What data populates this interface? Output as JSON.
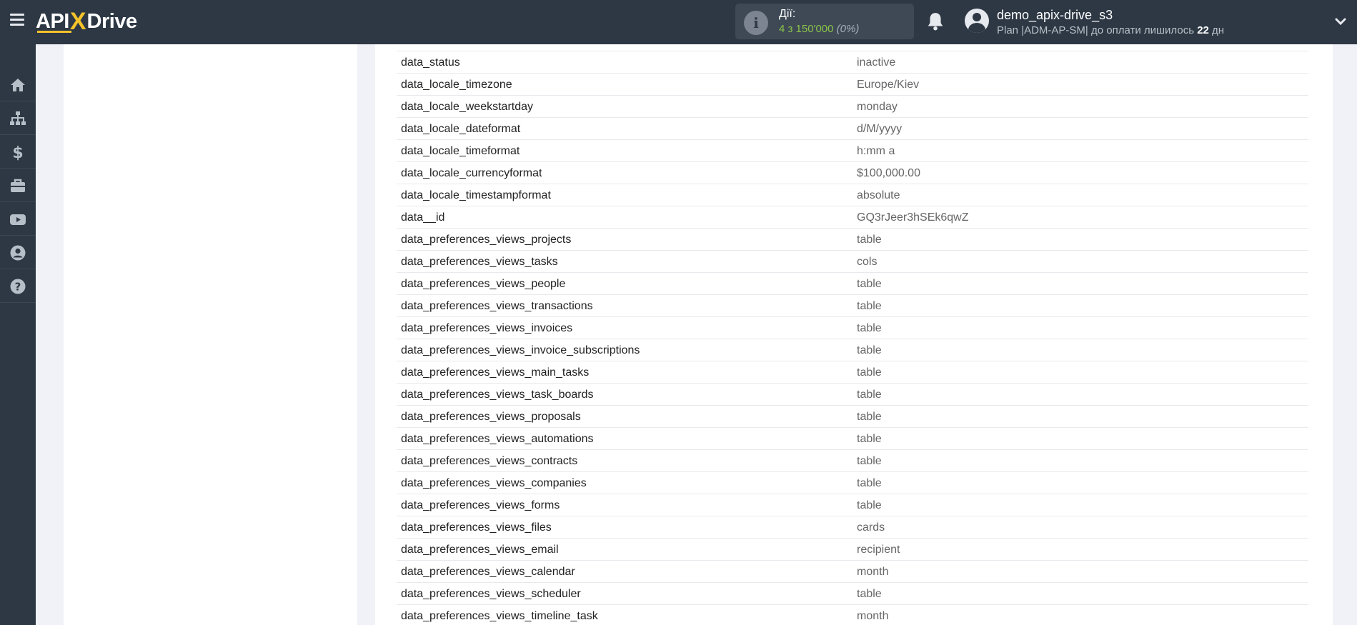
{
  "header": {
    "logo_left": "API",
    "logo_x": "X",
    "logo_right": "Drive",
    "actions_label": "Дії:",
    "actions_count": "4 з 150'000",
    "actions_percent": "(0%)",
    "username": "demo_apix-drive_s3",
    "plan_prefix": "Plan |ADM-AP-SM| до оплати лишилось ",
    "plan_days": "22",
    "plan_suffix": " дн"
  },
  "sidebar": {
    "items": [
      {
        "icon": "home-icon"
      },
      {
        "icon": "sitemap-icon"
      },
      {
        "icon": "dollar-icon"
      },
      {
        "icon": "briefcase-icon"
      },
      {
        "icon": "youtube-icon"
      },
      {
        "icon": "user-circle-icon"
      },
      {
        "icon": "question-circle-icon"
      }
    ]
  },
  "table": {
    "rows": [
      {
        "key": "data_status",
        "value": "inactive"
      },
      {
        "key": "data_locale_timezone",
        "value": "Europe/Kiev"
      },
      {
        "key": "data_locale_weekstartday",
        "value": "monday"
      },
      {
        "key": "data_locale_dateformat",
        "value": "d/M/yyyy"
      },
      {
        "key": "data_locale_timeformat",
        "value": "h:mm a"
      },
      {
        "key": "data_locale_currencyformat",
        "value": "$100,000.00"
      },
      {
        "key": "data_locale_timestampformat",
        "value": "absolute"
      },
      {
        "key": "data__id",
        "value": "GQ3rJeer3hSEk6qwZ"
      },
      {
        "key": "data_preferences_views_projects",
        "value": "table"
      },
      {
        "key": "data_preferences_views_tasks",
        "value": "cols"
      },
      {
        "key": "data_preferences_views_people",
        "value": "table"
      },
      {
        "key": "data_preferences_views_transactions",
        "value": "table"
      },
      {
        "key": "data_preferences_views_invoices",
        "value": "table"
      },
      {
        "key": "data_preferences_views_invoice_subscriptions",
        "value": "table"
      },
      {
        "key": "data_preferences_views_main_tasks",
        "value": "table"
      },
      {
        "key": "data_preferences_views_task_boards",
        "value": "table"
      },
      {
        "key": "data_preferences_views_proposals",
        "value": "table"
      },
      {
        "key": "data_preferences_views_automations",
        "value": "table"
      },
      {
        "key": "data_preferences_views_contracts",
        "value": "table"
      },
      {
        "key": "data_preferences_views_companies",
        "value": "table"
      },
      {
        "key": "data_preferences_views_forms",
        "value": "table"
      },
      {
        "key": "data_preferences_views_files",
        "value": "cards"
      },
      {
        "key": "data_preferences_views_email",
        "value": "recipient"
      },
      {
        "key": "data_preferences_views_calendar",
        "value": "month"
      },
      {
        "key": "data_preferences_views_scheduler",
        "value": "table"
      },
      {
        "key": "data_preferences_views_timeline_task",
        "value": "month"
      }
    ]
  }
}
